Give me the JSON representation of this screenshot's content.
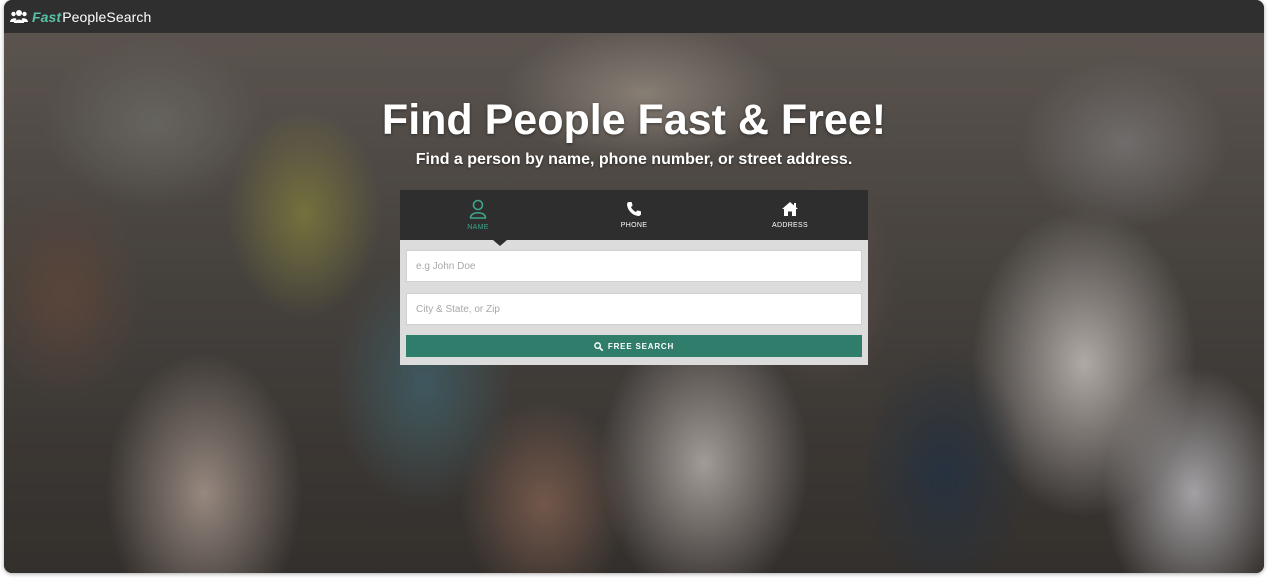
{
  "header": {
    "logo_fast": "Fast",
    "logo_rest": "PeopleSearch",
    "logo_icon": "users-icon"
  },
  "hero": {
    "title": "Find People Fast & Free!",
    "subtitle": "Find a person by name, phone number, or street address."
  },
  "search": {
    "tabs": [
      {
        "label": "NAME",
        "icon": "user-icon",
        "active": true
      },
      {
        "label": "PHONE",
        "icon": "phone-icon",
        "active": false
      },
      {
        "label": "ADDRESS",
        "icon": "home-icon",
        "active": false
      }
    ],
    "name_placeholder": "e.g John Doe",
    "location_placeholder": "City & State, or Zip",
    "button_label": "FREE SEARCH",
    "button_icon": "search-icon"
  },
  "colors": {
    "accent": "#3ea58b",
    "button": "#2f7d6a",
    "topbar": "#2f2f2f",
    "tabs_bg": "#2e2e2e"
  }
}
